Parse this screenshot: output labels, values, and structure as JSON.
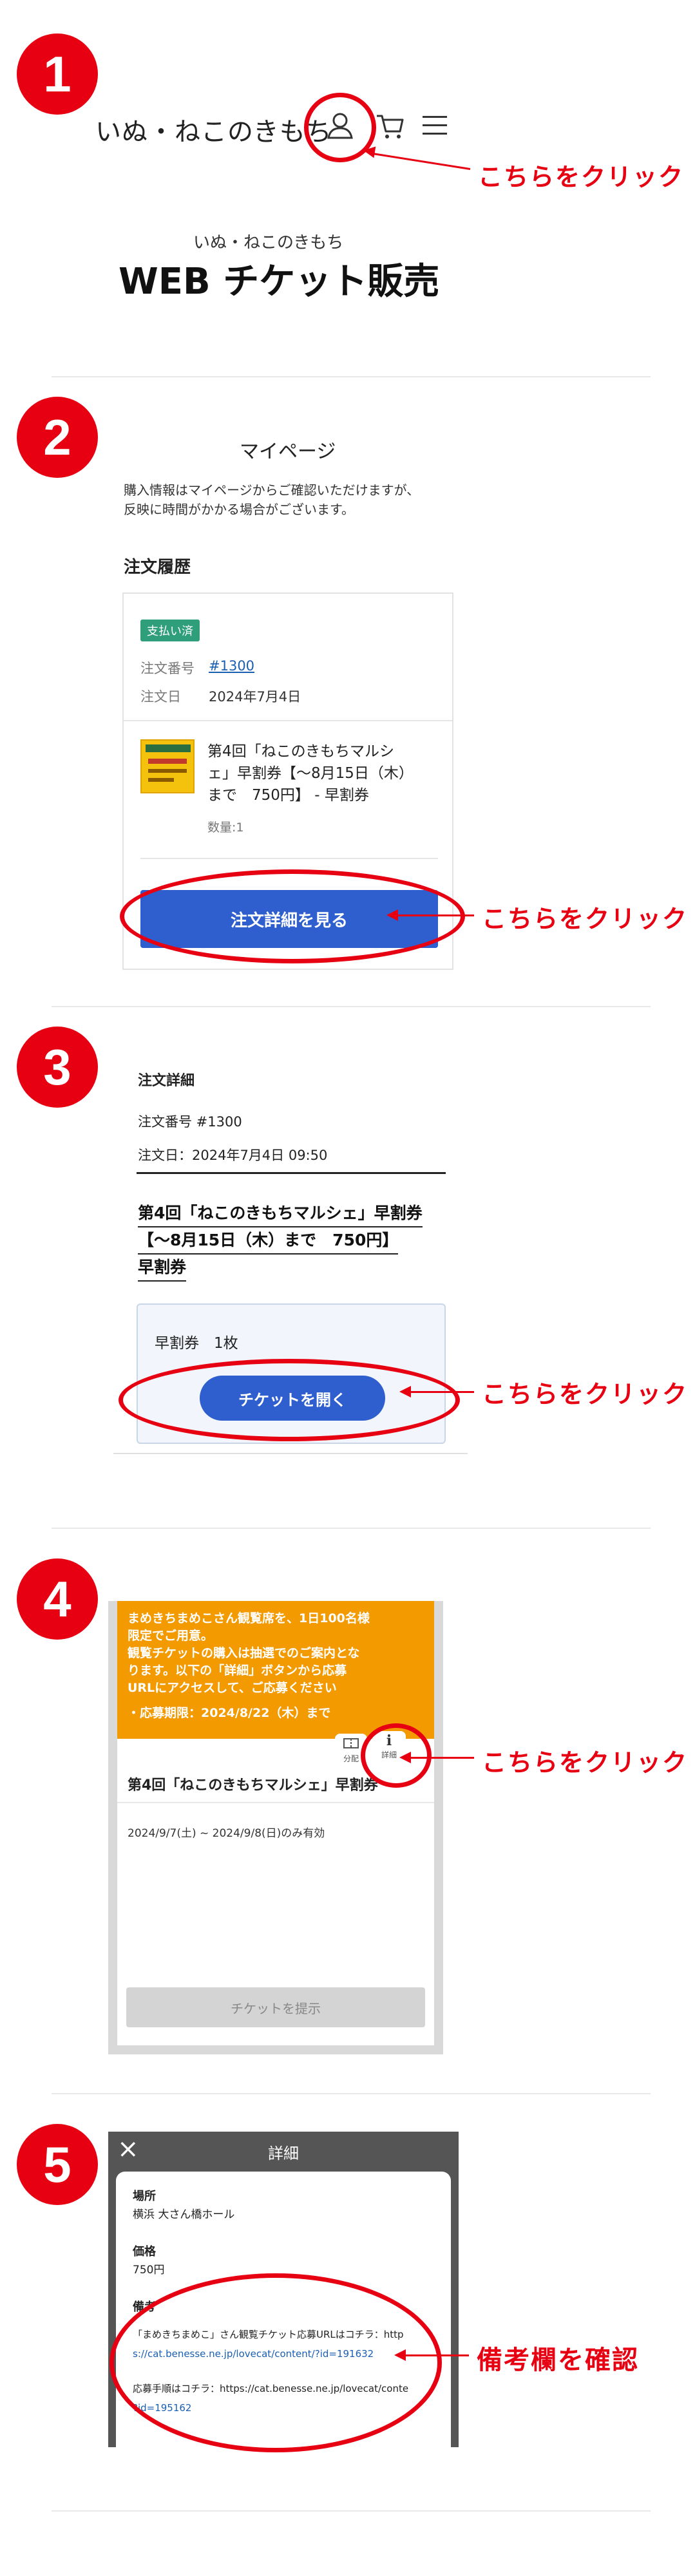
{
  "click_label": "こちらをクリック",
  "remarks_label": "備考欄を確認",
  "steps": [
    "1",
    "2",
    "3",
    "4",
    "5"
  ],
  "colors": {
    "accent_red": "#e60012",
    "button_blue": "#2f5fce",
    "paid_green": "#2f9e7a",
    "banner_orange": "#f29a00"
  },
  "section1": {
    "logo": "いぬ・ねこのきもち",
    "subtitle": "いぬ・ねこのきもち",
    "title": "WEB チケット販売",
    "icons": [
      "user-icon",
      "cart-icon",
      "menu-icon"
    ]
  },
  "section2": {
    "heading": "マイページ",
    "notice_line1": "購入情報はマイページからご確認いただけますが、",
    "notice_line2": "反映に時間がかかる場合がございます。",
    "history_label": "注文履歴",
    "status_badge": "支払い済",
    "order_number_label": "注文番号",
    "order_number": "#1300",
    "order_date_label": "注文日",
    "order_date": "2024年7月4日",
    "product_line1": "第4回「ねこのきもちマルシ",
    "product_line2": "ェ」早割券【〜8月15日（木）",
    "product_line3": "まで　750円】 - 早割券",
    "quantity": "数量:1",
    "detail_button": "注文詳細を見る"
  },
  "section3": {
    "heading": "注文詳細",
    "order_number": "注文番号 #1300",
    "order_date": "注文日：2024年7月4日 09:50",
    "product_line1": "第4回「ねこのきもちマルシェ」早割券",
    "product_line2": "【〜8月15日（木）まで　750円】",
    "product_line3": "早割券",
    "ticket_summary": "早割券　1枚",
    "open_button": "チケットを開く"
  },
  "section4": {
    "banner_line1": "まめきちまめこさん観覧席を、1日100名様",
    "banner_line2": "限定でご用意。",
    "banner_line3": "観覧チケットの購入は抽選でのご案内とな",
    "banner_line4": "ります。以下の「詳細」ボタンから応募",
    "banner_line5": "URLにアクセスして、ご応募ください",
    "banner_deadline": "・応募期限：2024/8/22（木）まで",
    "split_label": "分配",
    "detail_label": "詳細",
    "event_title": "第4回「ねこのきもちマルシェ」早割券",
    "validity": "2024/9/7(土) ~ 2024/9/8(日)のみ有効",
    "present_button": "チケットを提示"
  },
  "section5": {
    "sheet_title": "詳細",
    "place_label": "場所",
    "place_value": "横浜 大さん橋ホール",
    "price_label": "価格",
    "price_value": "750円",
    "remarks_label": "備考",
    "remarks_line1": "「まめきちまめこ」さん観覧チケット応募URLはコチラ：http",
    "remarks_line2": "s://cat.benesse.ne.jp/lovecat/content/?id=191632",
    "remarks_line3": "応募手順はコチラ：https://cat.benesse.ne.jp/lovecat/conte",
    "remarks_line4": "?id=195162"
  }
}
